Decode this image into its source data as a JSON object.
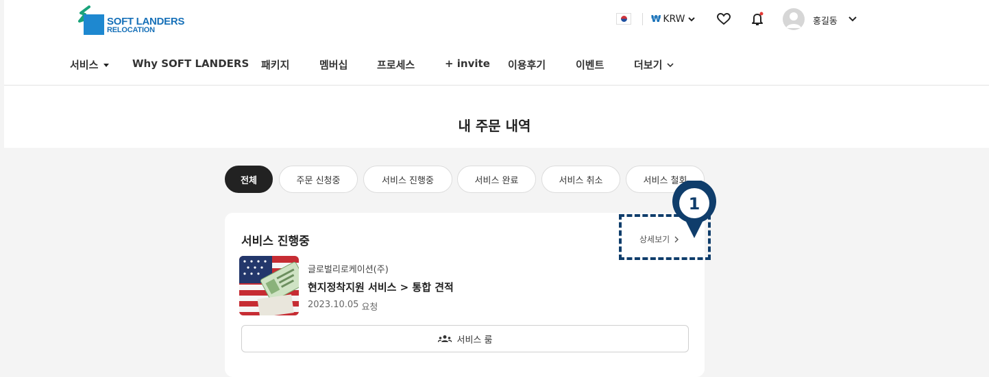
{
  "header": {
    "logo": {
      "line1": "SOFT LANDERS",
      "line2": "RELOCATION"
    },
    "currency": {
      "symbol": "₩",
      "code": "KRW"
    },
    "user": {
      "name": "홍길동"
    }
  },
  "nav": {
    "items": [
      {
        "label": "서비스"
      },
      {
        "label": "Why SOFT LANDERS"
      },
      {
        "label": "패키지"
      },
      {
        "label": "멤버십"
      },
      {
        "label": "프로세스"
      },
      {
        "label": "+ invite"
      },
      {
        "label": "이용후기"
      },
      {
        "label": "이벤트"
      },
      {
        "label": "더보기"
      }
    ]
  },
  "page": {
    "title": "내 주문 내역"
  },
  "tabs": [
    {
      "label": "전체",
      "active": true
    },
    {
      "label": "주문 신청중"
    },
    {
      "label": "서비스 진행중"
    },
    {
      "label": "서비스 완료"
    },
    {
      "label": "서비스 취소"
    },
    {
      "label": "서비스 철회"
    }
  ],
  "order_card": {
    "status_title": "서비스 진행중",
    "detail_label": "상세보기",
    "company": "글로벌리로케이션(주)",
    "service": "현지정착지원 서비스 > 통합 견적",
    "date": "2023.10.05",
    "date_suffix": "요청",
    "room_button": "서비스 룸"
  },
  "annotation": {
    "marker_number": "1",
    "color": "#0f3d6b"
  },
  "colors": {
    "brand": "#1670b8",
    "notification_dot": "#e53935",
    "active_tab": "#222222"
  }
}
